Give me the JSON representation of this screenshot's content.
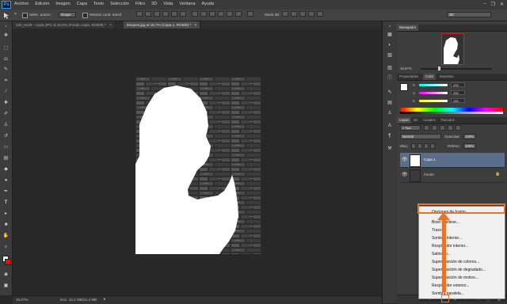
{
  "app": {
    "logo": "Ps"
  },
  "menu": [
    "Archivo",
    "Edición",
    "Imagen",
    "Capa",
    "Texto",
    "Selección",
    "Filtro",
    "3D",
    "Vista",
    "Ventana",
    "Ayuda"
  ],
  "window_controls": [
    "–",
    "❐",
    "✕"
  ],
  "options": {
    "check1_label": "Selec. autom.:",
    "group_value": "Grupo",
    "check2_label": "Mostrar contr. transf.",
    "mode3d_label": "Modo 3D:",
    "workspace_value": "3D"
  },
  "tabs": [
    {
      "label": "100_9129 - copia.JPG al 15,6% (Fondo copia, RGB/8) *",
      "close": "×"
    },
    {
      "label": "bloques.jpg al 16,7% (Capa 1, RGB/8) *",
      "close": "×"
    }
  ],
  "status": {
    "zoom": "16,67%",
    "doc": "Doc: 10,4 MB/21,4 MB"
  },
  "navigator": {
    "tab": "Navegador",
    "zoom": "16,67%"
  },
  "color_panel": {
    "tabs": [
      "Propiedades",
      "Color",
      "Muestras"
    ],
    "channels": [
      {
        "label": "R",
        "value": "255",
        "color": "#e03c3c"
      },
      {
        "label": "G",
        "value": "255",
        "color": "#3cd33c"
      },
      {
        "label": "B",
        "value": "255",
        "color": "#c03ce0"
      }
    ]
  },
  "layers_panel": {
    "tabs": [
      "Capas",
      "3D",
      "Canales",
      "Trazados"
    ],
    "filter_value": "Tipo",
    "blend_mode": "Normal",
    "opacity_label": "Opacidad:",
    "opacity_value": "100%",
    "lock_label": "Bloq.:",
    "fill_label": "Relleno:",
    "fill_value": "100%",
    "layers": [
      {
        "name": "Capa 1",
        "selected": true
      },
      {
        "name": "Fondo",
        "selected": false
      }
    ]
  },
  "context_menu": {
    "items": [
      "Opciones de fusión...",
      "Bisel y relieve...",
      "Trazo...",
      "Sombra interior...",
      "Resplandor interior...",
      "Satinado...",
      "Superposición de colores...",
      "Superposición de degradado...",
      "Superposición de motivo...",
      "Resplandor exterior...",
      "Sombra paralela..."
    ]
  },
  "colors": {
    "accent_highlight": "#e8742a",
    "selected_layer": "#5a6e8a"
  }
}
